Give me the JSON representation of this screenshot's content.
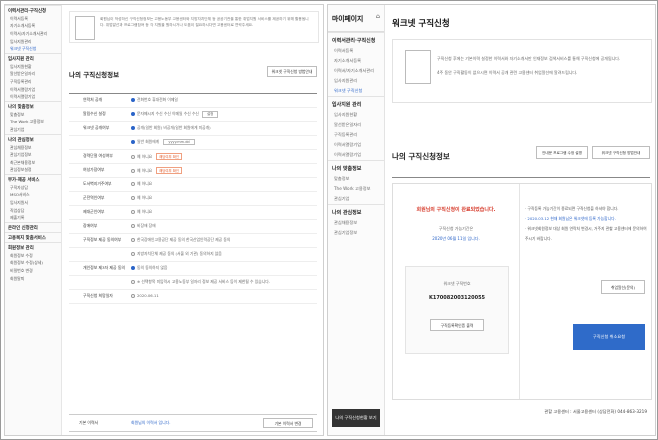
{
  "left_panel": {
    "sidebar": {
      "sections": [
        {
          "title": "이력서관리·구직신청",
          "items": [
            "이력서등록",
            "자기소개서등록",
            "이력서/자기소개서관리",
            "입사지원관리",
            "워크넷 구직신청"
          ],
          "active": 4
        },
        {
          "title": "입사지원 관리",
          "items": [
            "입사지원현황",
            "알선받은일자리",
            "구직등록관리",
            "이력서열람기업",
            "이력서열람기업"
          ]
        },
        {
          "title": "나의 맞춤정보",
          "items": [
            "맞춤정보",
            "The Work 고용정보",
            "관심기업"
          ]
        },
        {
          "title": "나의 관심정보",
          "items": [
            "관심채용정보",
            "관심기업정보",
            "최근본채용정보",
            "관심정보설정"
          ]
        },
        {
          "title": "부가·제공 서비스",
          "items": [
            "구직자상담",
            "MSO서비스",
            "입사지원서",
            "직업상담",
            "제출기록"
          ]
        },
        {
          "title": "온라인 신청관리",
          "items": []
        },
        {
          "title": "고용복지 맞춤서비스",
          "items": []
        },
        {
          "title": "회원정보 관리",
          "items": [
            "회원정보 수정",
            "회원정보 수정(상세)",
            "비밀번호 변경",
            "회원탈퇴"
          ]
        }
      ]
    },
    "notice": "회원님이 작성하신 구직신청정보는 고용노동부 고용센터와 지방자치단체 등 공공기관을 통한 취업지원 서비스를 제공하기 위해 활용됩니다. 취업알선과 프로그램참여 등 각 지원을 원하시거나 도움이 필요하시다면 고용센터로 연락주세요.",
    "section_title": "나의 구직신청정보",
    "top_button": "워크넷 구직신청 방법안내",
    "rows": [
      {
        "label": "연락처 공개",
        "value": "전화번호  휴대전화  이메일"
      },
      {
        "label": "알림수신 설정",
        "value": "문자메시지 수신  수신   이메일 수신  수신",
        "btn": "설정"
      },
      {
        "label": "워크넷 공개여부",
        "value": "공개(일반 회원)   비공개(일반 회원에게 미공개)"
      },
      {
        "label": "",
        "value": "일반 회원에게   ",
        "date": "yyyy.mm.dd"
      },
      {
        "label": "경력단절 여성여부",
        "value": "예   아니요",
        "tag": "해당여부 확인"
      },
      {
        "label": "여성가장여부",
        "value": "예   아니요",
        "tag": "해당여부 확인"
      },
      {
        "label": "도서벽지거주여부",
        "value": "예   아니요"
      },
      {
        "label": "군전역인여부",
        "value": "예   아니요"
      },
      {
        "label": "제대군인여부",
        "value": "예   아니요"
      },
      {
        "label": "장애여부",
        "value": "비장애   장애"
      },
      {
        "label": "구직정보 제공 동의여부",
        "value": "한국장애인고용공단 제공 동의   한국산업인력공단 제공 동의"
      },
      {
        "label": "",
        "value": "지방자치단체 제공 동의 (서울 외 기관)   동의하지 않음"
      },
      {
        "label": "개인정보 제3자 제공 동의",
        "value": "동의   동의하지 않음"
      },
      {
        "label": "",
        "value": "※ 선택항목 미입력시 고용노동부 일자리 정보 제공 서비스 등이 제한될 수 있습니다."
      },
      {
        "label": "구직신청 희망일자",
        "value": "2020.06.11"
      }
    ],
    "footer_label": "기본 이력서",
    "footer_value": "회원님의 이력서 입니다.",
    "footer_button": "기본 이력서 변경"
  },
  "right_panel": {
    "sidebar": {
      "title": "마이페이지",
      "sections": [
        {
          "title": "이력서관리·구직신청",
          "items": [
            "이력서등록",
            "자기소개서등록",
            "이력서/자기소개서관리",
            "입사지원관리",
            "워크넷 구직신청"
          ],
          "active": 4
        },
        {
          "title": "입사지원 관리",
          "items": [
            "입사지원현황",
            "알선받은일자리",
            "구직등록관리",
            "이력서열람기업",
            "이력서열람기업"
          ]
        },
        {
          "title": "나의 맞춤정보",
          "items": [
            "맞춤정보",
            "The Work 고용정보",
            "관심기업"
          ]
        },
        {
          "title": "나의 관심정보",
          "items": [
            "관심채용정보",
            "관심기업정보"
          ]
        }
      ],
      "bottom_button": "나의 구직신청현황 보기"
    },
    "page_title": "워크넷 구직신청",
    "notice_lines": [
      "구직신청 후에는 기본이력 설정한 이력서와 자기소개서만 인재정보 검색서비스를 통해 구직신청에 공개됩니다.",
      "4주 동안 구직활동이 없으시면 이력서 공개 관련 고용센터 취업알선에 알려드립니다."
    ],
    "section_title": "나의 구직신청정보",
    "buttons": [
      "안내문 프로그램 수정 설명",
      "워크넷 구직신청 방법안내"
    ],
    "status_title": "회원님의 구직신청이 완료되었습니다.",
    "status_sub": "구직신청 가능기간은",
    "status_date": "2020년 06월 11일 입니다.",
    "cert_label": "워크넷 구직번호",
    "cert_number": "K170082003120055",
    "cert_button": "구직등록확인증 출력",
    "info_lines": [
      "· 구직등록 가능기간이 종료되면 구직신청을 하셔야 합니다.",
      "· 2020.03.12 현재 회원님은 워크넷에 등록 가능합니다.",
      "· 워크넷회원정보 대상 회원 연락처 변경시, 거주지 관할 고용센터에 문의하여 주시기 바랍니다."
    ],
    "inquiry_button": "취업알선(문의)",
    "cancel_button": "구직신청 취소요청",
    "bottom_text": "관할 고용센터 : 서울고용센터 (상담전화) 044-863-3219"
  }
}
